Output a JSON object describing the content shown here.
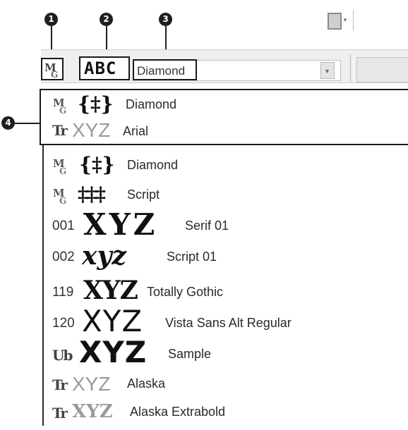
{
  "callouts": [
    "1",
    "2",
    "3",
    "4"
  ],
  "toolbar": {
    "mode_icon": "monogram-icon",
    "style_preview": "ABC",
    "font_select_value": "Diamond",
    "dropdown_icon": "chevron-down-icon",
    "color_button_icon": "thread-color-icon"
  },
  "recent_fonts": [
    {
      "type_icon": "monogram-icon",
      "type_glyph": "M̲G",
      "sample": "{‡}",
      "name": "Diamond"
    },
    {
      "type_icon": "truetype-icon",
      "type_glyph": "Tr",
      "sample": "XYZ",
      "name": "Arial"
    }
  ],
  "font_list": [
    {
      "prefix": "M̲G",
      "prefix_kind": "monogram-icon",
      "sample": "{‡}",
      "name": "Diamond"
    },
    {
      "prefix": "M̲G",
      "prefix_kind": "monogram-icon",
      "sample": "‡‡‡",
      "name": "Script"
    },
    {
      "prefix": "001",
      "prefix_kind": "number",
      "sample": "XYZ",
      "name": "Serif 01"
    },
    {
      "prefix": "002",
      "prefix_kind": "number",
      "sample": "xyz",
      "name": "Script 01"
    },
    {
      "prefix": "119",
      "prefix_kind": "number",
      "sample": "XYZ",
      "name": "Totally Gothic"
    },
    {
      "prefix": "120",
      "prefix_kind": "number",
      "sample": "XYZ",
      "name": "Vista Sans Alt Regular"
    },
    {
      "prefix": "Ub",
      "prefix_kind": "user-font-icon",
      "sample": "XYZ",
      "name": "Sample"
    },
    {
      "prefix": "Tr",
      "prefix_kind": "truetype-icon",
      "sample": "XYZ",
      "name": "Alaska"
    },
    {
      "prefix": "Tr",
      "prefix_kind": "truetype-icon",
      "sample": "XYZ",
      "name": "Alaska Extrabold"
    }
  ]
}
